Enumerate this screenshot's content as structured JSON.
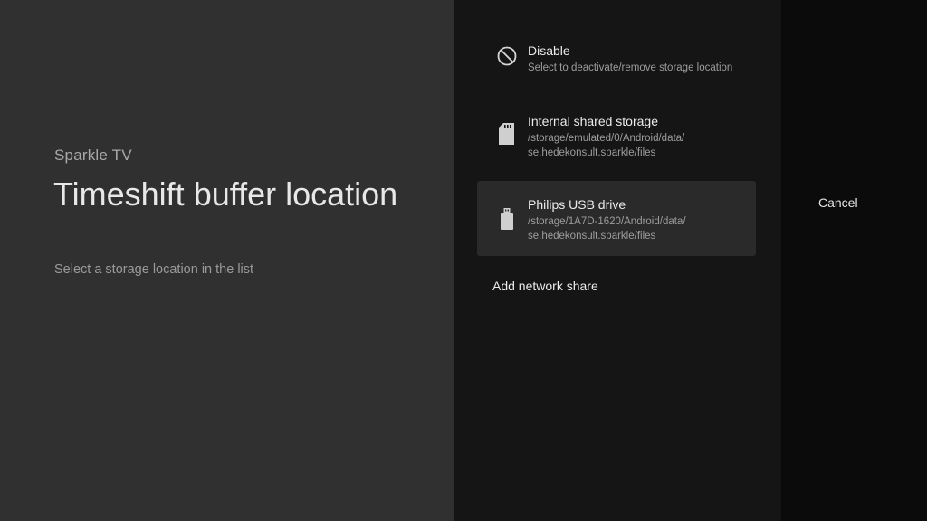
{
  "guidance": {
    "breadcrumb": "Sparkle TV",
    "title": "Timeshift buffer location",
    "description": "Select a storage location in the list"
  },
  "actions": [
    {
      "label": "Disable",
      "description": "Select to deactivate/remove storage location",
      "icon": "block-icon",
      "focused": false
    },
    {
      "label": "Internal shared storage",
      "description": "/storage/emulated/0/Android/data/ se.hedekonsult.sparkle/files",
      "icon": "sd-card-icon",
      "focused": false
    },
    {
      "label": "Philips USB drive",
      "description": "/storage/1A7D-1620/Android/data/ se.hedekonsult.sparkle/files",
      "icon": "usb-drive-icon",
      "focused": true
    },
    {
      "label": "Add network share",
      "focused": false
    }
  ],
  "buttons": {
    "cancel": "Cancel"
  },
  "colors": {
    "guidance_bg": "#303030",
    "actions_bg": "#151515",
    "buttons_bg": "#0b0b0b",
    "focused_bg": "#2a2a2a"
  }
}
